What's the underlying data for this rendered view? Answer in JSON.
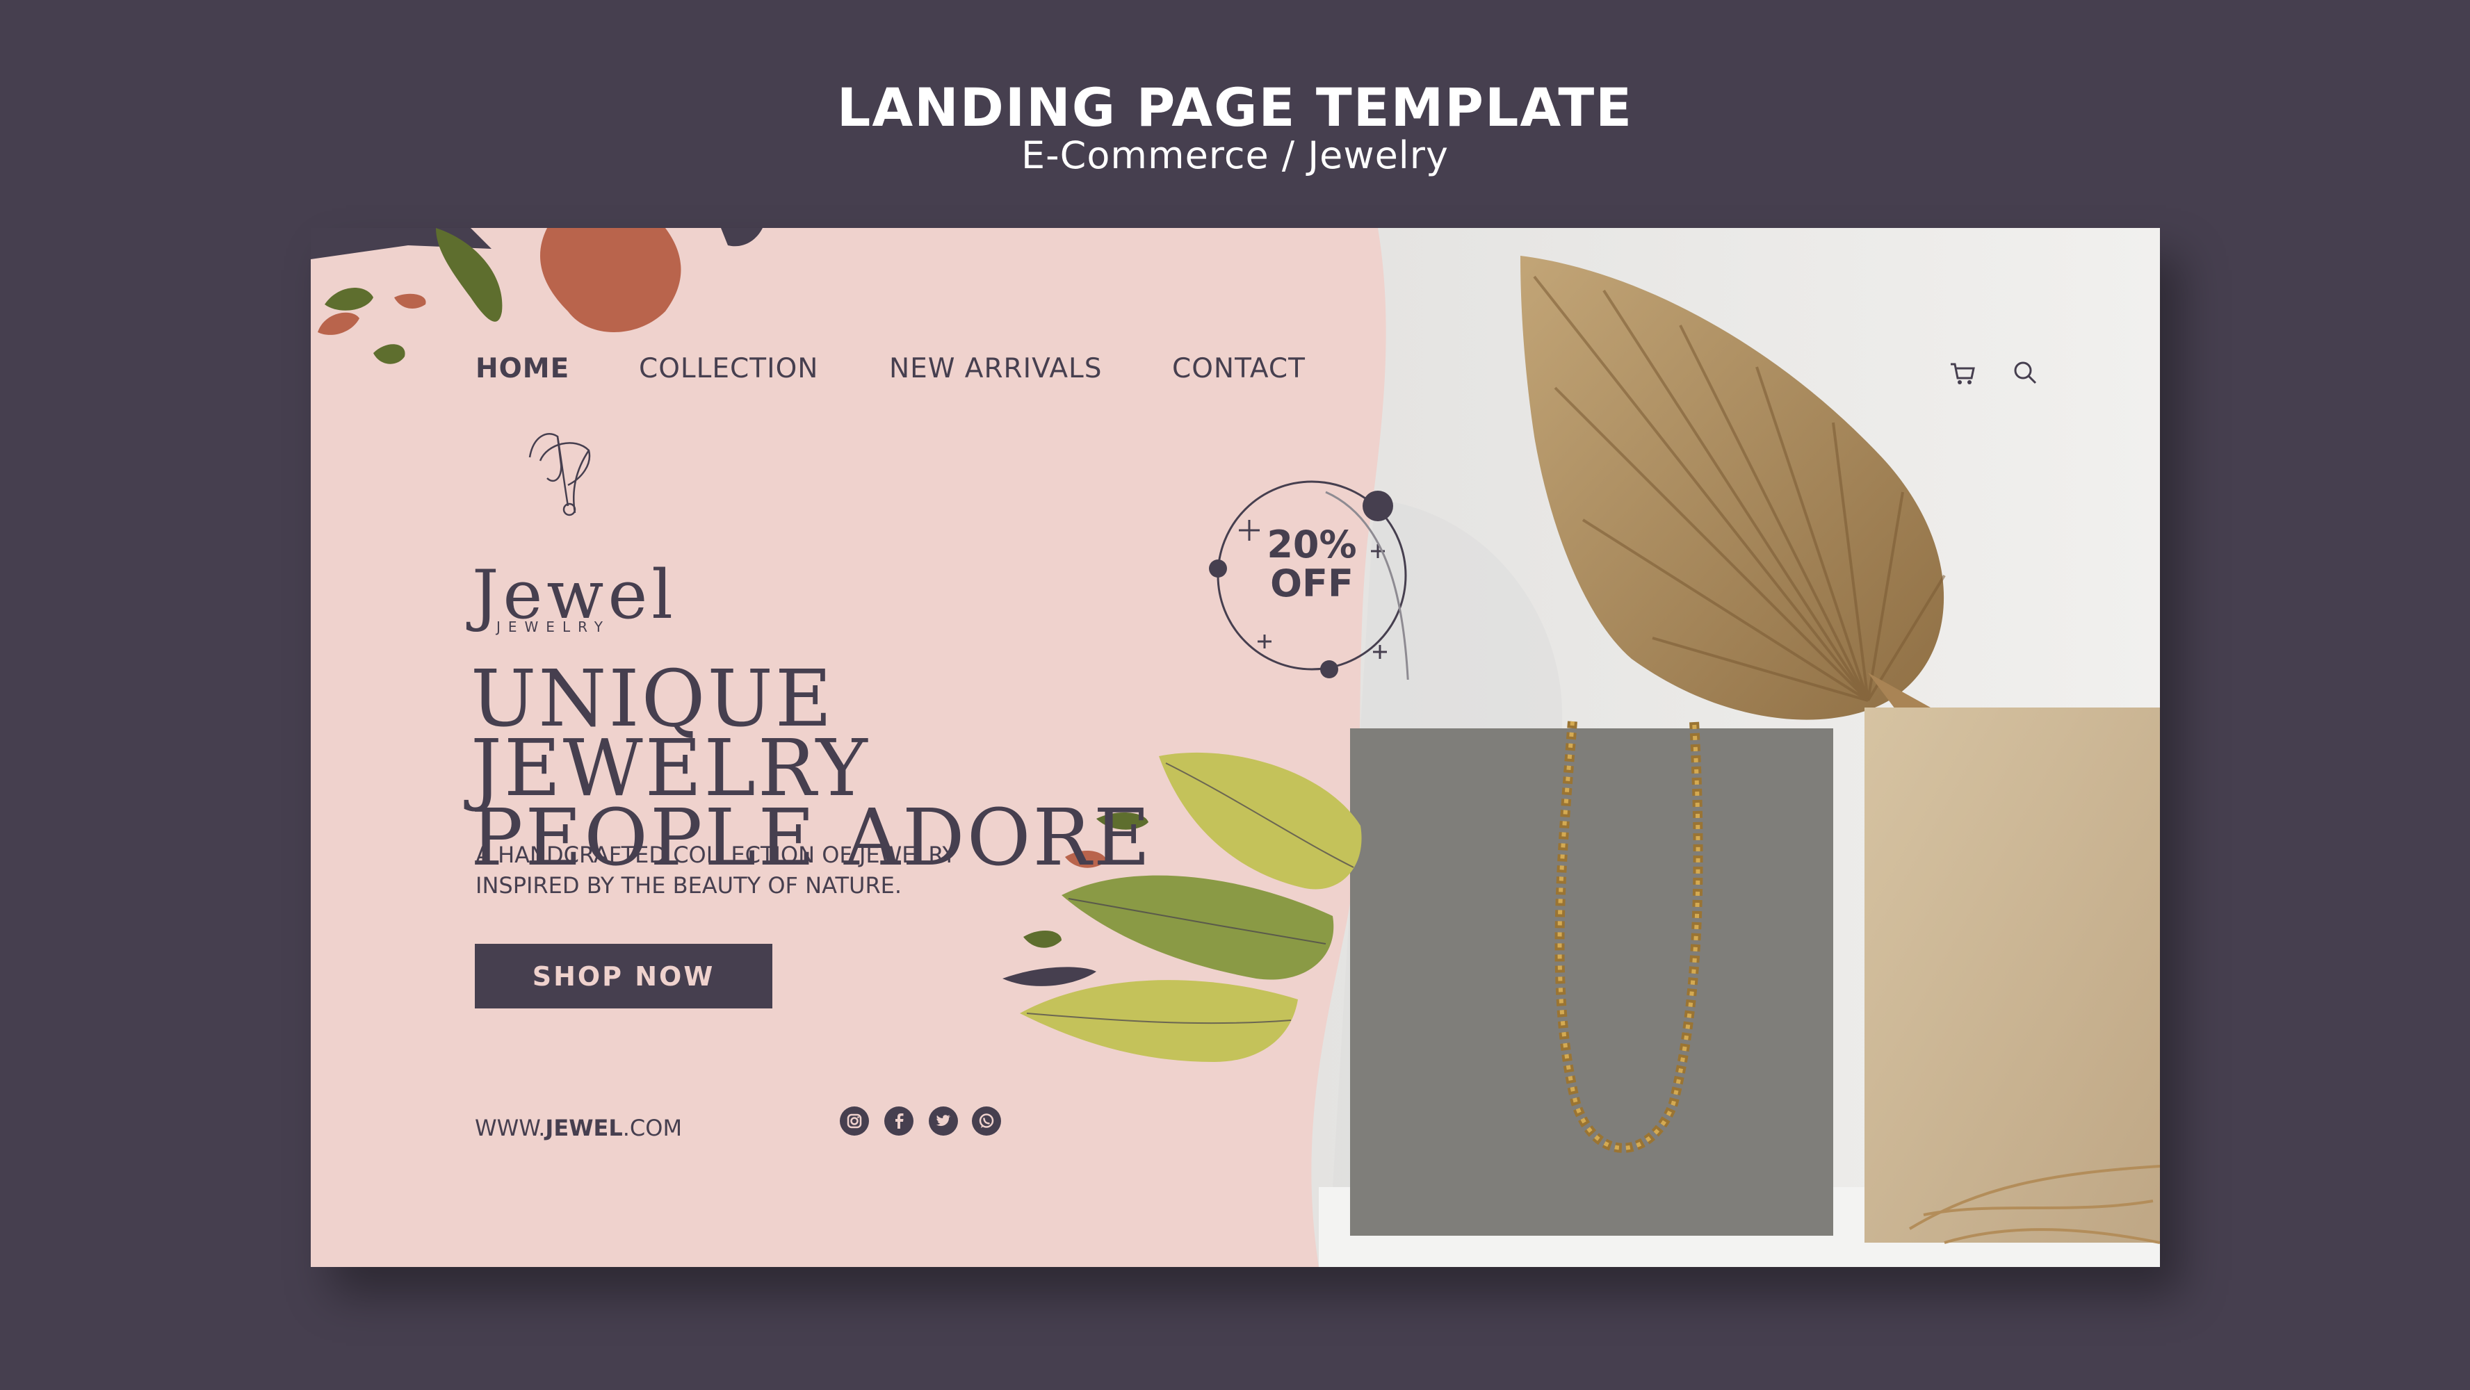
{
  "header": {
    "title": "LANDING PAGE TEMPLATE",
    "subtitle": "E-Commerce / Jewelry"
  },
  "nav": {
    "items": [
      {
        "label": "HOME",
        "active": true
      },
      {
        "label": "COLLECTION",
        "active": false
      },
      {
        "label": "NEW ARRIVALS",
        "active": false
      },
      {
        "label": "CONTACT",
        "active": false
      }
    ],
    "icons": [
      "cart-icon",
      "search-icon"
    ]
  },
  "logo": {
    "name": "Jewel",
    "sub": "JEWELRY"
  },
  "hero": {
    "headline": "UNIQUE JEWELRY\nPEOPLE ADORE",
    "tagline": "A HANDCRAFTED COLLECTION OF JEWELRY\nINSPIRED BY THE BEAUTY OF NATURE.",
    "cta_label": "SHOP NOW"
  },
  "discount": {
    "label": "20%\nOFF"
  },
  "footer": {
    "website_prefix": "WWW.",
    "website_bold": "JEWEL",
    "website_suffix": ".COM",
    "social": [
      "instagram-icon",
      "facebook-icon",
      "twitter-icon",
      "whatsapp-icon"
    ]
  },
  "colors": {
    "background": "#463f4f",
    "card": "#efd2cd",
    "accent_dark": "#463f4f",
    "terracotta": "#b7614a",
    "olive": "#5e6e2e",
    "leaf_yellow": "#b8b650"
  }
}
